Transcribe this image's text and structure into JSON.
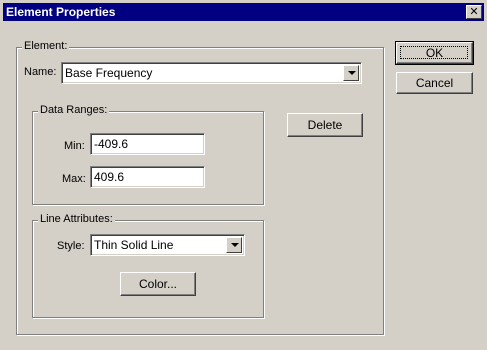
{
  "window": {
    "title": "Element Properties",
    "close_glyph": "✕"
  },
  "element_group": {
    "label": "Element:",
    "name_label": "Name:",
    "name_value": "Base Frequency"
  },
  "data_ranges": {
    "label": "Data Ranges:",
    "min_label": "Min:",
    "min_value": "-409.6",
    "max_label": "Max:",
    "max_value": "409.6"
  },
  "line_attributes": {
    "label": "Line Attributes:",
    "style_label": "Style:",
    "style_value": "Thin Solid Line",
    "color_button": "Color..."
  },
  "buttons": {
    "ok": "OK",
    "cancel": "Cancel",
    "delete": "Delete"
  },
  "icons": {
    "combo_arrow": "chevron-down-icon",
    "close": "close-icon"
  },
  "colors": {
    "titlebar": "#000080",
    "face": "#d4d0c8"
  }
}
